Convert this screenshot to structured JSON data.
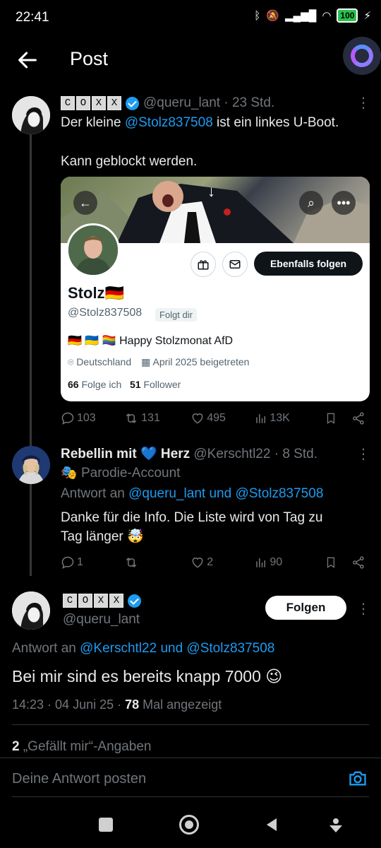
{
  "status": {
    "time": "22:41",
    "battery": "100"
  },
  "header": {
    "title": "Post"
  },
  "tweet1": {
    "coxx": [
      "C",
      "O",
      "X",
      "X"
    ],
    "handle_time": "@queru_lant · 23 Std.",
    "text_prefix": "Der kleine ",
    "mention": "@Stolz837508",
    "text_suffix": " ist ein linkes U-Boot.",
    "text_line2": "Kann geblockt werden.",
    "actions": {
      "replies": "103",
      "reposts": "131",
      "likes": "495",
      "views": "13K"
    }
  },
  "card": {
    "follow_label": "Ebenfalls folgen",
    "name": "Stolz",
    "flag": "🇩🇪",
    "handle": "@Stolz837508",
    "follows_you": "Folgt dir",
    "bio_emojis": "🇩🇪 🇺🇦 🏳️‍🌈",
    "bio_text": "Happy Stolzmonat AfD",
    "location": "Deutschland",
    "joined": "April 2025 beigetreten",
    "following_count": "66",
    "following_label": "Folge ich",
    "followers_count": "51",
    "followers_label": "Follower"
  },
  "tweet2": {
    "name_prefix": "Rebellin mit ",
    "heart": "💙",
    "name_suffix": " Herz",
    "handle_time": "@Kerschtl22 · 8 Std.",
    "parody_icon": "🎭",
    "parody": "Parodie-Account",
    "reply_to_label": "Antwort an ",
    "reply_to": "@queru_lant und @Stolz837508",
    "text_line1": "Danke für die Info. Die Liste wird von Tag zu",
    "text_line2": "Tag länger 🤯",
    "actions": {
      "replies": "1",
      "reposts": "",
      "likes": "2",
      "views": "90"
    }
  },
  "main_tweet": {
    "coxx": [
      "C",
      "O",
      "X",
      "X"
    ],
    "handle": "@queru_lant",
    "follow_label": "Folgen",
    "reply_to_label": "Antwort an ",
    "reply_to": "@Kerschtl22 und @Stolz837508",
    "text": "Bei mir sind es bereits knapp 7000 😉",
    "time": "14:23 · 04 Juni 25 · ",
    "views_count": "78",
    "views_label": " Mal angezeigt",
    "likes_count": "2",
    "likes_label": "„Gefällt mir“-Angaben"
  },
  "reply_bar": {
    "placeholder": "Deine Antwort posten"
  },
  "colors": {
    "accent": "#1d9bf0",
    "background": "#000000",
    "muted": "#71767b"
  }
}
